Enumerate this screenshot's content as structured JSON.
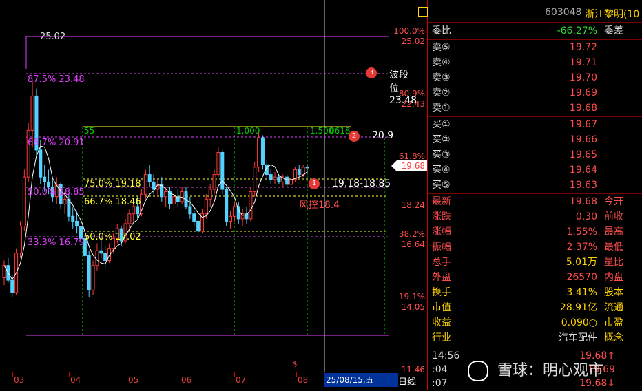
{
  "panel": {
    "code": "603048",
    "name": "浙江黎明(10",
    "weibi_label": "委比",
    "weibi_value": "-66.27%",
    "weicha_label": "委差",
    "asks": [
      {
        "label": "卖⑤",
        "price": "19.72"
      },
      {
        "label": "卖④",
        "price": "19.71"
      },
      {
        "label": "卖③",
        "price": "19.70"
      },
      {
        "label": "卖②",
        "price": "19.69"
      },
      {
        "label": "卖①",
        "price": "19.68"
      }
    ],
    "bids": [
      {
        "label": "买①",
        "price": "19.67"
      },
      {
        "label": "买②",
        "price": "19.66"
      },
      {
        "label": "买③",
        "price": "19.65"
      },
      {
        "label": "买④",
        "price": "19.64"
      },
      {
        "label": "买⑤",
        "price": "19.63"
      }
    ],
    "stats": [
      {
        "label": "最新",
        "value": "19.68",
        "right": "今开",
        "color": "#ff4d4d"
      },
      {
        "label": "涨跌",
        "value": "0.30",
        "right": "前收",
        "color": "#ff4d4d"
      },
      {
        "label": "涨幅",
        "value": "1.55%",
        "right": "最高",
        "color": "#ff4d4d"
      },
      {
        "label": "振幅",
        "value": "2.37%",
        "right": "最低",
        "color": "#ff4d4d"
      },
      {
        "label": "总手",
        "value": "5.01万",
        "right": "量比",
        "color": "#ffd400"
      },
      {
        "label": "外盘",
        "value": "26570",
        "right": "内盘",
        "color": "#ff4d4d"
      },
      {
        "label": "换手",
        "value": "3.41%",
        "right": "股本",
        "color": "#ffd400"
      },
      {
        "label": "市值",
        "value": "28.91亿",
        "right": "流通",
        "color": "#ffd400"
      },
      {
        "label": "收益",
        "value": "0.090○",
        "right": "市盈",
        "color": "#ffd400"
      },
      {
        "label": "行业",
        "value": "汽车配件",
        "right": "概念",
        "color": "#dddddd"
      }
    ],
    "ticks": [
      {
        "time": "14:56",
        "price": "19.68↑"
      },
      {
        "time": ":04",
        "price": "19.69"
      },
      {
        "time": ":07",
        "price": "19.68↓"
      }
    ],
    "watermark": "雪球：明心观市"
  },
  "axis": {
    "pct_100": "100.0%",
    "p_2502": "25.02",
    "pct_809": "80.9%",
    "p_2243": "22.43",
    "pct_618": "61.8%",
    "current": "19.68",
    "p_1824": "18.24",
    "pct_382": "38.2%",
    "p_1664": "16.64",
    "pct_191": "19.1%",
    "p_1405": "14.05",
    "p_1146": "11.46"
  },
  "fib": {
    "top": "25.02",
    "f875": "87.5% 23.48",
    "f667": "66.7% 20.91",
    "f500": "50.0% 18.85",
    "f333": "33.3% 16.79",
    "g55": "55",
    "g1000": "1.000",
    "g1500": "1.500",
    "g0618": "0618",
    "y750": "75.0% 19.18",
    "y667": "66.7% 18.46",
    "y500": "50.0% 17.02"
  },
  "annotations": {
    "a3": "波段位23.48",
    "a2": "20.9",
    "a1": "19.18-18.85",
    "risk": "风控18.4",
    "n1": "1",
    "n2": "2",
    "n3": "3"
  },
  "xaxis": {
    "months": [
      "03",
      "04",
      "05",
      "06",
      "07",
      "08"
    ],
    "date": "25/08/15,五",
    "period": "日线"
  },
  "colors": {
    "up": "#ff3b3b",
    "down": "#54d2ff",
    "fib": "#e040fb",
    "gold": "#ffff33",
    "grid": "#00cc00"
  },
  "chart_data": {
    "type": "candlestick",
    "price_range": [
      11.46,
      25.02
    ],
    "fib_levels_pink": [
      {
        "pct": "100.0%",
        "price": 25.02
      },
      {
        "pct": "87.5%",
        "price": 23.48
      },
      {
        "pct": "66.7%",
        "price": 20.91
      },
      {
        "pct": "50.0%",
        "price": 18.85
      },
      {
        "pct": "33.3%",
        "price": 16.79
      }
    ],
    "fib_levels_yellow": [
      {
        "pct": "75.0%",
        "price": 19.18
      },
      {
        "pct": "66.7%",
        "price": 18.46
      },
      {
        "pct": "50.0%",
        "price": 17.02
      }
    ],
    "ohlc": [
      [
        15.2,
        15.9,
        14.9,
        15.7
      ],
      [
        15.7,
        16.0,
        15.0,
        15.1
      ],
      [
        15.1,
        15.3,
        14.4,
        14.6
      ],
      [
        14.6,
        16.4,
        14.5,
        16.2
      ],
      [
        16.2,
        17.5,
        16.0,
        17.3
      ],
      [
        17.3,
        19.6,
        17.1,
        19.3
      ],
      [
        19.3,
        21.5,
        19.1,
        21.2
      ],
      [
        21.2,
        23.2,
        20.5,
        22.6
      ],
      [
        22.6,
        22.9,
        20.1,
        20.4
      ],
      [
        20.4,
        20.8,
        19.0,
        19.3
      ],
      [
        19.3,
        19.8,
        18.7,
        19.1
      ],
      [
        19.1,
        19.6,
        18.6,
        18.9
      ],
      [
        18.9,
        19.2,
        18.3,
        18.5
      ],
      [
        18.5,
        19.3,
        18.2,
        19.0
      ],
      [
        19.0,
        19.1,
        18.0,
        18.2
      ],
      [
        18.2,
        18.7,
        17.8,
        18.4
      ],
      [
        18.4,
        18.6,
        17.5,
        17.7
      ],
      [
        17.7,
        18.1,
        17.2,
        17.5
      ],
      [
        17.5,
        17.9,
        17.0,
        17.3
      ],
      [
        17.3,
        17.6,
        16.6,
        16.8
      ],
      [
        16.8,
        17.0,
        15.9,
        16.1
      ],
      [
        16.1,
        16.3,
        14.4,
        14.7
      ],
      [
        14.7,
        15.9,
        14.5,
        15.7
      ],
      [
        15.7,
        16.6,
        15.5,
        16.3
      ],
      [
        16.3,
        16.9,
        16.0,
        16.2
      ],
      [
        16.2,
        16.5,
        15.6,
        15.9
      ],
      [
        15.9,
        16.6,
        15.8,
        16.4
      ],
      [
        16.4,
        17.0,
        16.2,
        16.8
      ],
      [
        16.8,
        17.4,
        16.6,
        17.2
      ],
      [
        17.2,
        17.3,
        16.5,
        16.7
      ],
      [
        16.7,
        17.6,
        16.6,
        17.4
      ],
      [
        17.4,
        18.0,
        17.1,
        17.8
      ],
      [
        17.8,
        18.3,
        17.5,
        18.1
      ],
      [
        18.1,
        18.5,
        17.6,
        17.8
      ],
      [
        17.8,
        18.8,
        17.7,
        18.6
      ],
      [
        18.6,
        19.6,
        18.4,
        19.4
      ],
      [
        19.4,
        19.8,
        18.9,
        19.1
      ],
      [
        19.1,
        19.4,
        18.6,
        18.8
      ],
      [
        18.8,
        19.2,
        18.5,
        19.0
      ],
      [
        19.0,
        19.3,
        18.3,
        18.5
      ],
      [
        18.5,
        18.9,
        18.1,
        18.7
      ],
      [
        18.7,
        18.9,
        18.0,
        18.2
      ],
      [
        18.2,
        18.7,
        17.9,
        18.5
      ],
      [
        18.5,
        18.8,
        18.1,
        18.3
      ],
      [
        18.3,
        18.9,
        18.2,
        18.7
      ],
      [
        18.7,
        18.9,
        18.0,
        18.1
      ],
      [
        18.1,
        18.5,
        17.6,
        17.8
      ],
      [
        17.8,
        18.0,
        17.3,
        17.5
      ],
      [
        17.5,
        17.7,
        16.9,
        17.1
      ],
      [
        17.1,
        18.0,
        17.0,
        17.8
      ],
      [
        17.8,
        18.6,
        17.6,
        18.4
      ],
      [
        18.4,
        19.0,
        18.1,
        18.8
      ],
      [
        18.8,
        19.6,
        18.6,
        19.4
      ],
      [
        19.4,
        20.5,
        19.3,
        20.3
      ],
      [
        20.3,
        20.4,
        18.6,
        18.8
      ],
      [
        18.8,
        18.9,
        17.3,
        17.5
      ],
      [
        17.5,
        17.9,
        17.2,
        17.7
      ],
      [
        17.7,
        18.3,
        17.5,
        18.1
      ],
      [
        18.1,
        18.3,
        17.4,
        17.6
      ],
      [
        17.6,
        18.0,
        17.3,
        17.8
      ],
      [
        17.8,
        18.1,
        17.4,
        17.6
      ],
      [
        17.6,
        18.9,
        17.5,
        18.7
      ],
      [
        18.7,
        19.9,
        18.5,
        19.7
      ],
      [
        19.7,
        21.2,
        19.5,
        20.9
      ],
      [
        20.9,
        21.0,
        19.6,
        19.8
      ],
      [
        19.8,
        20.0,
        19.2,
        19.4
      ],
      [
        19.4,
        19.6,
        19.0,
        19.2
      ],
      [
        19.2,
        19.5,
        19.0,
        19.3
      ],
      [
        19.3,
        19.4,
        19.0,
        19.1
      ],
      [
        19.1,
        19.4,
        18.9,
        19.3
      ],
      [
        19.3,
        19.4,
        18.9,
        19.0
      ],
      [
        19.0,
        19.3,
        18.9,
        19.2
      ],
      [
        19.2,
        19.7,
        19.1,
        19.6
      ],
      [
        19.6,
        19.8,
        19.3,
        19.4
      ],
      [
        19.4,
        19.8,
        19.3,
        19.7
      ],
      [
        19.7,
        19.8,
        19.4,
        19.68
      ]
    ]
  }
}
